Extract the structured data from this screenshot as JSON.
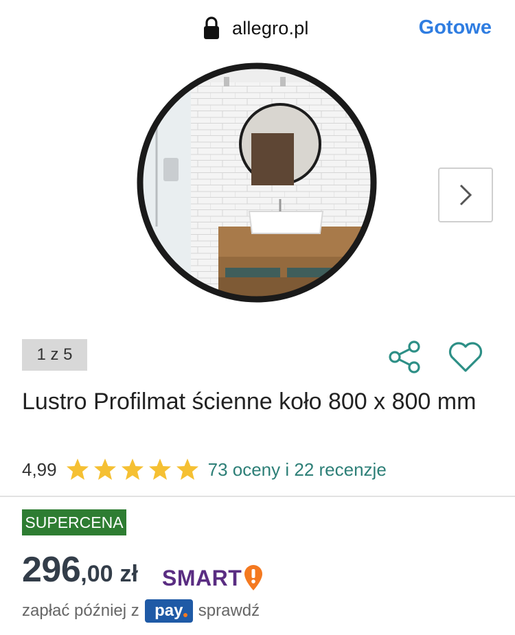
{
  "browser": {
    "url": "allegro.pl",
    "done_label": "Gotowe"
  },
  "gallery": {
    "counter": "1 z 5"
  },
  "product": {
    "title": "Lustro Profilmat ścienne koło 800 x 800 mm",
    "rating": "4,99",
    "stars": 5,
    "reviews_link": "73 oceny i 22 recenzje",
    "badge": "SUPERCENA",
    "price_int": "296",
    "price_dec": ",00",
    "currency": "zł",
    "smart_label": "SMART",
    "pay_later_text": "zapłać później z",
    "pay_logo": "pay",
    "check_label": "sprawdź"
  },
  "colors": {
    "link_blue": "#2f7de1",
    "accent_teal": "#2d7f77",
    "star_yellow": "#f5c033",
    "badge_green": "#2e7d32",
    "smart_purple": "#5a2d82",
    "smart_orange": "#f47920",
    "pay_blue": "#1f5aa6"
  },
  "icons": [
    "lock-icon",
    "chevron-right-icon",
    "share-icon",
    "heart-icon",
    "star-icon",
    "smart-exclamation-icon"
  ]
}
